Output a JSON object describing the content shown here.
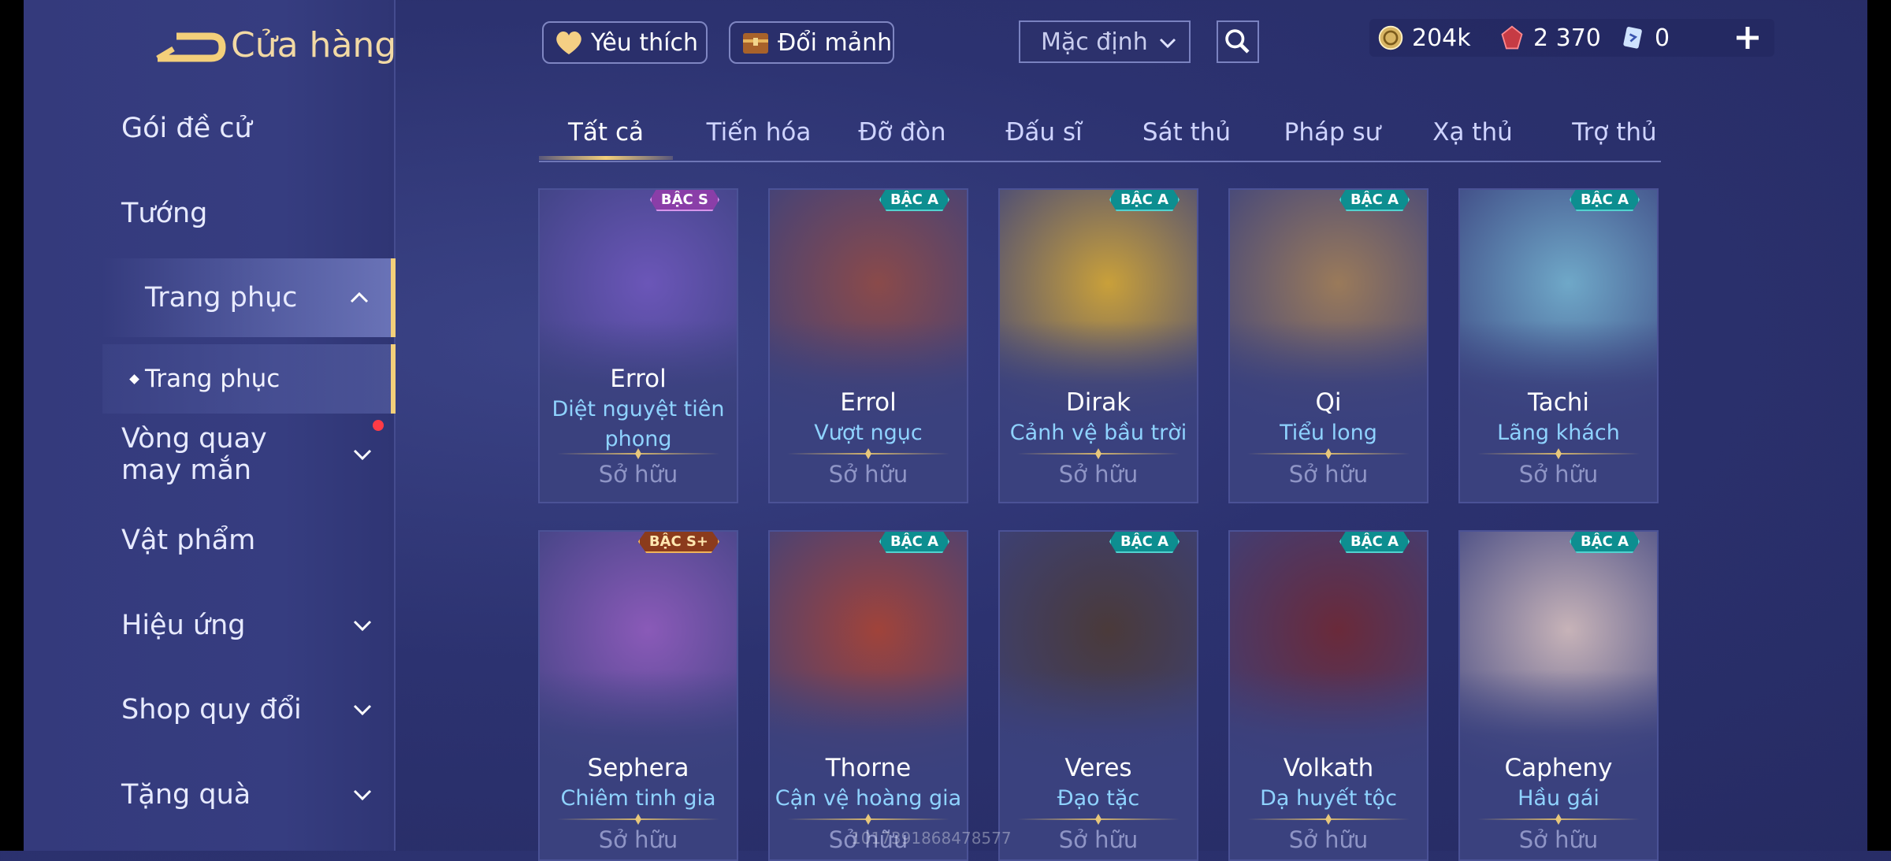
{
  "header": {
    "title": "Cửa hàng"
  },
  "sidebar": {
    "items": [
      {
        "label": "Gói đề cử"
      },
      {
        "label": "Tướng"
      },
      {
        "label": "Trang phục"
      },
      {
        "label": "Trang phục"
      },
      {
        "label": "Vòng quay may mắn"
      },
      {
        "label": "Vật phẩm"
      },
      {
        "label": "Hiệu ứng"
      },
      {
        "label": "Shop quy đổi"
      },
      {
        "label": "Tặng quà"
      }
    ]
  },
  "topbar": {
    "favorite_label": "Yêu thích",
    "exchange_label": "Đổi mảnh",
    "sort_value": "Mặc định",
    "currencies": [
      {
        "icon": "gold-coin-icon",
        "value": "204k"
      },
      {
        "icon": "red-gem-icon",
        "value": "2 370"
      },
      {
        "icon": "ticket-icon",
        "value": "0"
      }
    ]
  },
  "tabs": [
    {
      "label": "Tất cả"
    },
    {
      "label": "Tiến hóa"
    },
    {
      "label": "Đỡ đòn"
    },
    {
      "label": "Đấu sĩ"
    },
    {
      "label": "Sát thủ"
    },
    {
      "label": "Pháp sư"
    },
    {
      "label": "Xạ thủ"
    },
    {
      "label": "Trợ thủ"
    }
  ],
  "skins": [
    {
      "hero": "Errol",
      "skin": "Diệt nguyệt tiên phong",
      "status": "Sở hữu",
      "badge": "BẬC S",
      "accent": "#6b56b8"
    },
    {
      "hero": "Errol",
      "skin": "Vượt ngục",
      "status": "Sở hữu",
      "badge": "BẬC A",
      "accent": "#8a4a4a"
    },
    {
      "hero": "Dirak",
      "skin": "Cảnh vệ bầu trời",
      "status": "Sở hữu",
      "badge": "BẬC A",
      "accent": "#c9a03a"
    },
    {
      "hero": "Qi",
      "skin": "Tiểu long",
      "status": "Sở hữu",
      "badge": "BẬC A",
      "accent": "#9a7a5a"
    },
    {
      "hero": "Tachi",
      "skin": "Lãng khách",
      "status": "Sở hữu",
      "badge": "BẬC A",
      "accent": "#6fa8c8"
    },
    {
      "hero": "Sephera",
      "skin": "Chiêm tinh gia",
      "status": "Sở hữu",
      "badge": "BẬC S+",
      "accent": "#8a5ab8"
    },
    {
      "hero": "Thorne",
      "skin": "Cận vệ hoàng gia",
      "status": "Sở hữu",
      "badge": "BẬC A",
      "accent": "#a0433a"
    },
    {
      "hero": "Veres",
      "skin": "Đạo tặc",
      "status": "Sở hữu",
      "badge": "BẬC A",
      "accent": "#4a3a3a"
    },
    {
      "hero": "Volkath",
      "skin": "Dạ huyết tộc",
      "status": "Sở hữu",
      "badge": "BẬC A",
      "accent": "#6a2a3a"
    },
    {
      "hero": "Capheny",
      "skin": "Hầu gái",
      "status": "Sở hữu",
      "badge": "BẬC A",
      "accent": "#c7b3b8"
    }
  ],
  "watermark": "1017391868478577"
}
